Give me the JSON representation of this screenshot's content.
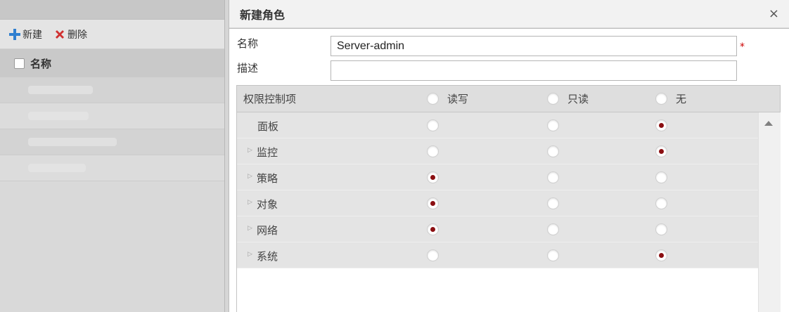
{
  "toolbar": {
    "new_label": "新建",
    "delete_label": "删除"
  },
  "list": {
    "header": "名称",
    "rows": 4
  },
  "dialog": {
    "title": "新建角色",
    "close_symbol": "×",
    "name_label": "名称",
    "name_value": "Server-admin",
    "required_mark": "*",
    "desc_label": "描述",
    "desc_value": "",
    "perm_header": {
      "label": "权限控制项",
      "options": [
        "读写",
        "只读",
        "无"
      ]
    },
    "permissions": [
      {
        "label": "面板",
        "expandable": false,
        "selected": 2
      },
      {
        "label": "监控",
        "expandable": true,
        "selected": 2
      },
      {
        "label": "策略",
        "expandable": true,
        "selected": 0
      },
      {
        "label": "对象",
        "expandable": true,
        "selected": 0
      },
      {
        "label": "网络",
        "expandable": true,
        "selected": 0
      },
      {
        "label": "系统",
        "expandable": true,
        "selected": 2
      }
    ]
  },
  "colors": {
    "radio_dot": "#8b0f12",
    "required": "#cc0000",
    "add_icon": "#2f7fd0",
    "delete_icon": "#d03030"
  }
}
